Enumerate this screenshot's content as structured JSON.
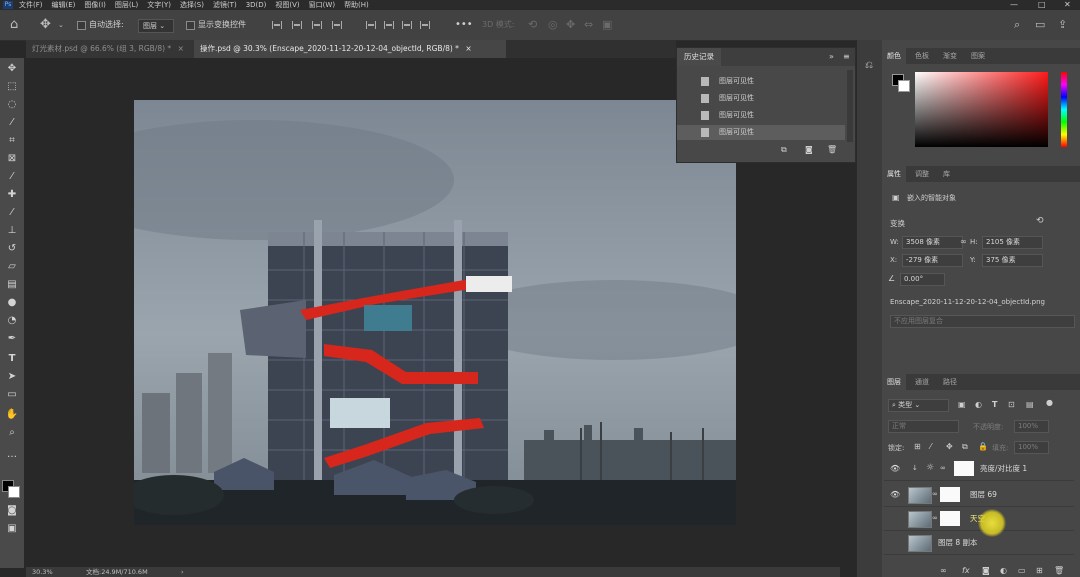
{
  "app": {
    "logo": "Ps"
  },
  "menu": [
    "文件(F)",
    "编辑(E)",
    "图像(I)",
    "图层(L)",
    "文字(Y)",
    "选择(S)",
    "滤镜(T)",
    "3D(D)",
    "视图(V)",
    "窗口(W)",
    "帮助(H)"
  ],
  "window_controls": {
    "minimize": "—",
    "maximize": "□",
    "close": "✕"
  },
  "options_bar": {
    "auto_select_label": "自动选择:",
    "auto_select_value": "图层",
    "show_transform_label": "显示变换控件",
    "mode_3d_label": "3D 模式:",
    "more": "•••"
  },
  "tabs": [
    {
      "label": "灯光素材.psd @ 66.6% (组 3, RGB/8) *",
      "close": "×"
    },
    {
      "label": "操作.psd @ 30.3% (Enscape_2020-11-12-20-12-04_objectId, RGB/8) *",
      "close": "×"
    }
  ],
  "toolbar": {
    "icons": [
      "move-tool-icon",
      "marquee-tool-icon",
      "lasso-tool-icon",
      "quick-select-tool-icon",
      "crop-tool-icon",
      "frame-tool-icon",
      "eyedropper-tool-icon",
      "healing-brush-tool-icon",
      "brush-tool-icon",
      "clone-stamp-tool-icon",
      "history-brush-tool-icon",
      "eraser-tool-icon",
      "gradient-tool-icon",
      "blur-tool-icon",
      "dodge-tool-icon",
      "pen-tool-icon",
      "type-tool-icon",
      "path-select-tool-icon",
      "rectangle-tool-icon",
      "hand-tool-icon",
      "zoom-tool-icon",
      "more-tools-icon"
    ]
  },
  "status": {
    "zoom": "30.3%",
    "doc_size": "文档:24.9M/710.6M",
    "arrow": "›"
  },
  "history": {
    "tab": "历史记录",
    "collapse": "»",
    "menu": "≡",
    "items": [
      "图层可见性",
      "图层可见性",
      "图层可见性",
      "图层可见性"
    ]
  },
  "color_panel": {
    "tabs": [
      "颜色",
      "色板",
      "渐变",
      "图案"
    ],
    "field_hue": "#ff1a1a"
  },
  "properties": {
    "tabs": [
      "属性",
      "调整",
      "库"
    ],
    "type": "嵌入的智能对象",
    "section": "变换",
    "w_label": "W:",
    "w": "3508 像素",
    "h_label": "H:",
    "h": "2105 像素",
    "x_label": "X:",
    "x": "-279 像素",
    "y_label": "Y:",
    "y": "375 像素",
    "angle": "0.00°",
    "filename": "Enscape_2020-11-12-20-12-04_objectId.png",
    "comps": "不应用图层复合"
  },
  "layers": {
    "tabs": [
      "图层",
      "通道",
      "路径"
    ],
    "filter": "类型",
    "blend": "正常",
    "opacity_label": "不透明度:",
    "opacity": "100%",
    "lock_label": "锁定:",
    "fill_label": "填充:",
    "fill": "100%",
    "rows": [
      {
        "name": "亮度/对比度 1",
        "visible": true
      },
      {
        "name": "图层 69",
        "visible": true
      },
      {
        "name": "天空",
        "visible": false
      },
      {
        "name": "图层 8 副本",
        "visible": false
      }
    ],
    "bottom_icons": [
      "link-icon",
      "fx-icon",
      "mask-icon",
      "adjustment-icon",
      "group-icon",
      "new-layer-icon",
      "trash-icon"
    ]
  }
}
